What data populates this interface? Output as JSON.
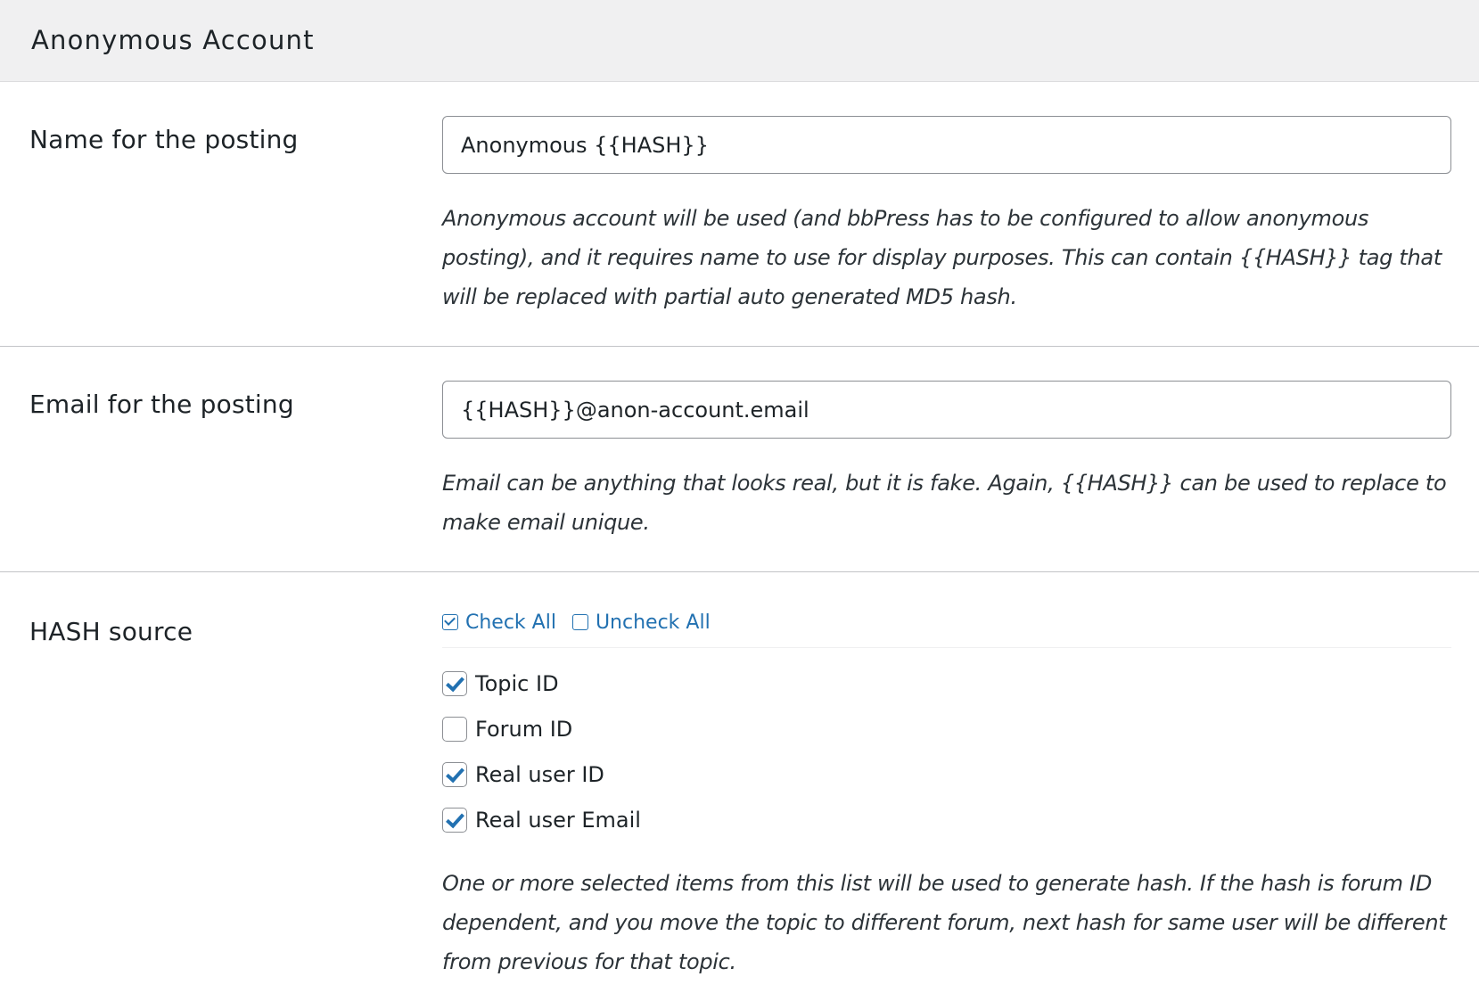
{
  "section": {
    "title": "Anonymous Account"
  },
  "name_row": {
    "label": "Name for the posting",
    "value": "Anonymous {{HASH}}",
    "description": "Anonymous account will be used (and bbPress has to be configured to allow anonymous posting), and it requires name to use for display purposes. This can contain {{HASH}} tag that will be replaced with partial auto generated MD5 hash."
  },
  "email_row": {
    "label": "Email for the posting",
    "value": "{{HASH}}@anon-account.email",
    "description": "Email can be anything that looks real, but it is fake. Again, {{HASH}} can be used to replace to make email unique."
  },
  "hash_row": {
    "label": "HASH source",
    "check_all_label": "Check All",
    "uncheck_all_label": "Uncheck All",
    "options": [
      {
        "label": "Topic ID",
        "checked": true
      },
      {
        "label": "Forum ID",
        "checked": false
      },
      {
        "label": "Real user ID",
        "checked": true
      },
      {
        "label": "Real user Email",
        "checked": true
      }
    ],
    "description": "One or more selected items from this list will be used to generate hash. If the hash is forum ID dependent, and you move the topic to different forum, next hash for same user will be different from previous for that topic."
  },
  "colors": {
    "accent": "#2271b1",
    "header_bg": "#f0f0f1",
    "text": "#1d2327"
  }
}
